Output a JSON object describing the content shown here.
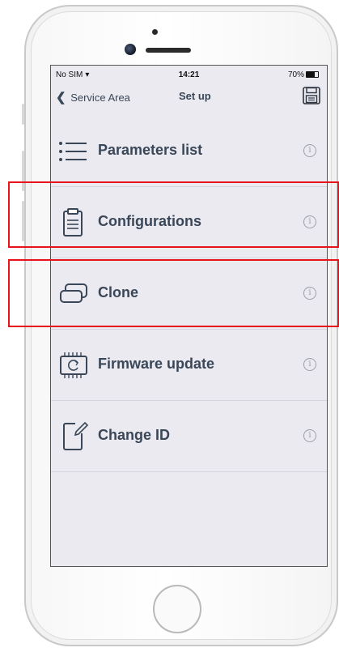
{
  "status": {
    "carrier": "No SIM",
    "time": "14:21",
    "battery": "70%"
  },
  "nav": {
    "back_label": "Service Area",
    "title": "Set up"
  },
  "items": [
    {
      "label": "Parameters list",
      "icon": "list-icon"
    },
    {
      "label": "Configurations",
      "icon": "clipboard-icon"
    },
    {
      "label": "Clone",
      "icon": "clone-icon"
    },
    {
      "label": "Firmware update",
      "icon": "chip-refresh-icon"
    },
    {
      "label": "Change ID",
      "icon": "edit-document-icon"
    }
  ],
  "highlight_color": "#e8141c",
  "text_color": "#3a4758"
}
